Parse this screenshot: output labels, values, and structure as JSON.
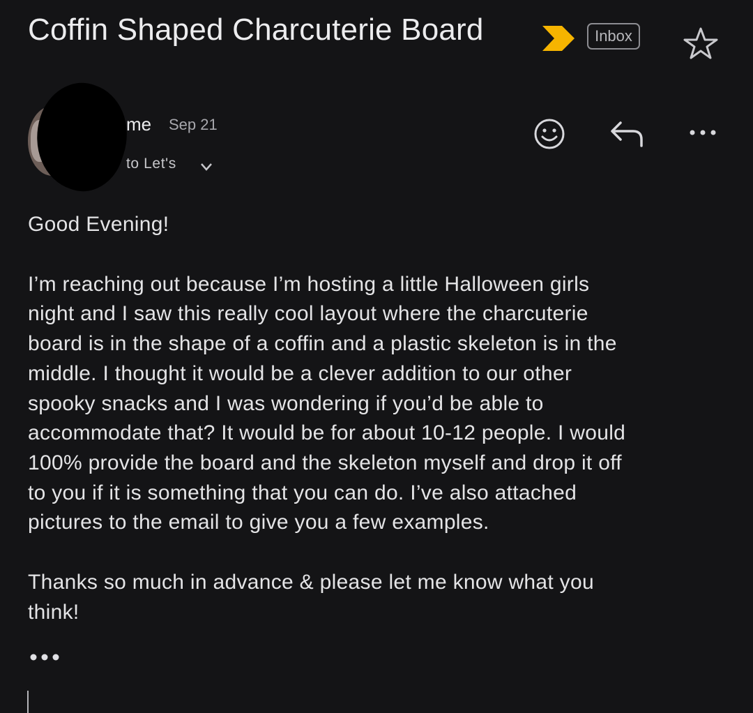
{
  "header": {
    "subject": "Coffin Shaped Charcuterie Board",
    "label_chip": "Inbox",
    "importance_color": "#f6b400",
    "icons": [
      "importance-marker-icon",
      "star-icon"
    ]
  },
  "message": {
    "sender": "me",
    "date": "Sep 21",
    "recipient": "to Let's",
    "actions": [
      "emoji-reaction-icon",
      "reply-icon",
      "more-options-icon"
    ],
    "body": [
      "Good Evening!",
      "I’m reaching out because I’m hosting a little Halloween girls\nnight and I saw this really cool layout where the charcuterie\nboard is in the shape of a coffin and a plastic skeleton is in the\nmiddle. I thought it would be a clever addition to our other\nspooky snacks and I was wondering if you’d be able to\naccommodate that?  It would be for about 10-12 people. I would\n100% provide the board and the skeleton myself and drop it off\nto you if it is something that you can do. I’ve also attached\npictures to the email to give you a few examples.",
      "Thanks so much in advance & please let me know what you\nthink!"
    ]
  }
}
